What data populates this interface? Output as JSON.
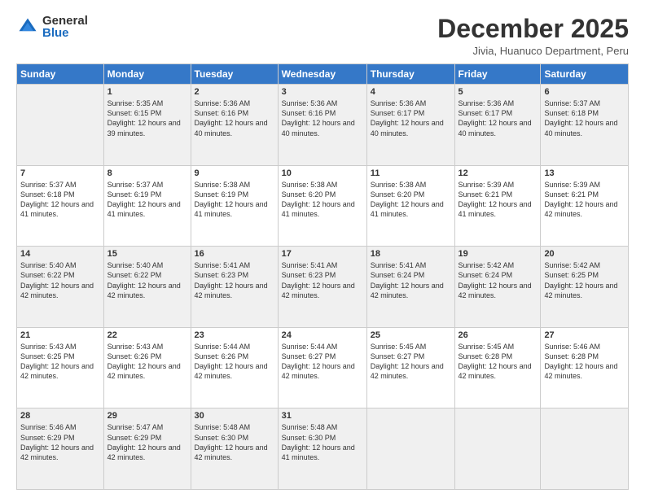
{
  "logo": {
    "general": "General",
    "blue": "Blue"
  },
  "header": {
    "title": "December 2025",
    "subtitle": "Jivia, Huanuco Department, Peru"
  },
  "columns": [
    "Sunday",
    "Monday",
    "Tuesday",
    "Wednesday",
    "Thursday",
    "Friday",
    "Saturday"
  ],
  "weeks": [
    [
      {
        "day": "",
        "sunrise": "",
        "sunset": "",
        "daylight": ""
      },
      {
        "day": "1",
        "sunrise": "Sunrise: 5:35 AM",
        "sunset": "Sunset: 6:15 PM",
        "daylight": "Daylight: 12 hours and 39 minutes."
      },
      {
        "day": "2",
        "sunrise": "Sunrise: 5:36 AM",
        "sunset": "Sunset: 6:16 PM",
        "daylight": "Daylight: 12 hours and 40 minutes."
      },
      {
        "day": "3",
        "sunrise": "Sunrise: 5:36 AM",
        "sunset": "Sunset: 6:16 PM",
        "daylight": "Daylight: 12 hours and 40 minutes."
      },
      {
        "day": "4",
        "sunrise": "Sunrise: 5:36 AM",
        "sunset": "Sunset: 6:17 PM",
        "daylight": "Daylight: 12 hours and 40 minutes."
      },
      {
        "day": "5",
        "sunrise": "Sunrise: 5:36 AM",
        "sunset": "Sunset: 6:17 PM",
        "daylight": "Daylight: 12 hours and 40 minutes."
      },
      {
        "day": "6",
        "sunrise": "Sunrise: 5:37 AM",
        "sunset": "Sunset: 6:18 PM",
        "daylight": "Daylight: 12 hours and 40 minutes."
      }
    ],
    [
      {
        "day": "7",
        "sunrise": "Sunrise: 5:37 AM",
        "sunset": "Sunset: 6:18 PM",
        "daylight": "Daylight: 12 hours and 41 minutes."
      },
      {
        "day": "8",
        "sunrise": "Sunrise: 5:37 AM",
        "sunset": "Sunset: 6:19 PM",
        "daylight": "Daylight: 12 hours and 41 minutes."
      },
      {
        "day": "9",
        "sunrise": "Sunrise: 5:38 AM",
        "sunset": "Sunset: 6:19 PM",
        "daylight": "Daylight: 12 hours and 41 minutes."
      },
      {
        "day": "10",
        "sunrise": "Sunrise: 5:38 AM",
        "sunset": "Sunset: 6:20 PM",
        "daylight": "Daylight: 12 hours and 41 minutes."
      },
      {
        "day": "11",
        "sunrise": "Sunrise: 5:38 AM",
        "sunset": "Sunset: 6:20 PM",
        "daylight": "Daylight: 12 hours and 41 minutes."
      },
      {
        "day": "12",
        "sunrise": "Sunrise: 5:39 AM",
        "sunset": "Sunset: 6:21 PM",
        "daylight": "Daylight: 12 hours and 41 minutes."
      },
      {
        "day": "13",
        "sunrise": "Sunrise: 5:39 AM",
        "sunset": "Sunset: 6:21 PM",
        "daylight": "Daylight: 12 hours and 42 minutes."
      }
    ],
    [
      {
        "day": "14",
        "sunrise": "Sunrise: 5:40 AM",
        "sunset": "Sunset: 6:22 PM",
        "daylight": "Daylight: 12 hours and 42 minutes."
      },
      {
        "day": "15",
        "sunrise": "Sunrise: 5:40 AM",
        "sunset": "Sunset: 6:22 PM",
        "daylight": "Daylight: 12 hours and 42 minutes."
      },
      {
        "day": "16",
        "sunrise": "Sunrise: 5:41 AM",
        "sunset": "Sunset: 6:23 PM",
        "daylight": "Daylight: 12 hours and 42 minutes."
      },
      {
        "day": "17",
        "sunrise": "Sunrise: 5:41 AM",
        "sunset": "Sunset: 6:23 PM",
        "daylight": "Daylight: 12 hours and 42 minutes."
      },
      {
        "day": "18",
        "sunrise": "Sunrise: 5:41 AM",
        "sunset": "Sunset: 6:24 PM",
        "daylight": "Daylight: 12 hours and 42 minutes."
      },
      {
        "day": "19",
        "sunrise": "Sunrise: 5:42 AM",
        "sunset": "Sunset: 6:24 PM",
        "daylight": "Daylight: 12 hours and 42 minutes."
      },
      {
        "day": "20",
        "sunrise": "Sunrise: 5:42 AM",
        "sunset": "Sunset: 6:25 PM",
        "daylight": "Daylight: 12 hours and 42 minutes."
      }
    ],
    [
      {
        "day": "21",
        "sunrise": "Sunrise: 5:43 AM",
        "sunset": "Sunset: 6:25 PM",
        "daylight": "Daylight: 12 hours and 42 minutes."
      },
      {
        "day": "22",
        "sunrise": "Sunrise: 5:43 AM",
        "sunset": "Sunset: 6:26 PM",
        "daylight": "Daylight: 12 hours and 42 minutes."
      },
      {
        "day": "23",
        "sunrise": "Sunrise: 5:44 AM",
        "sunset": "Sunset: 6:26 PM",
        "daylight": "Daylight: 12 hours and 42 minutes."
      },
      {
        "day": "24",
        "sunrise": "Sunrise: 5:44 AM",
        "sunset": "Sunset: 6:27 PM",
        "daylight": "Daylight: 12 hours and 42 minutes."
      },
      {
        "day": "25",
        "sunrise": "Sunrise: 5:45 AM",
        "sunset": "Sunset: 6:27 PM",
        "daylight": "Daylight: 12 hours and 42 minutes."
      },
      {
        "day": "26",
        "sunrise": "Sunrise: 5:45 AM",
        "sunset": "Sunset: 6:28 PM",
        "daylight": "Daylight: 12 hours and 42 minutes."
      },
      {
        "day": "27",
        "sunrise": "Sunrise: 5:46 AM",
        "sunset": "Sunset: 6:28 PM",
        "daylight": "Daylight: 12 hours and 42 minutes."
      }
    ],
    [
      {
        "day": "28",
        "sunrise": "Sunrise: 5:46 AM",
        "sunset": "Sunset: 6:29 PM",
        "daylight": "Daylight: 12 hours and 42 minutes."
      },
      {
        "day": "29",
        "sunrise": "Sunrise: 5:47 AM",
        "sunset": "Sunset: 6:29 PM",
        "daylight": "Daylight: 12 hours and 42 minutes."
      },
      {
        "day": "30",
        "sunrise": "Sunrise: 5:48 AM",
        "sunset": "Sunset: 6:30 PM",
        "daylight": "Daylight: 12 hours and 42 minutes."
      },
      {
        "day": "31",
        "sunrise": "Sunrise: 5:48 AM",
        "sunset": "Sunset: 6:30 PM",
        "daylight": "Daylight: 12 hours and 41 minutes."
      },
      {
        "day": "",
        "sunrise": "",
        "sunset": "",
        "daylight": ""
      },
      {
        "day": "",
        "sunrise": "",
        "sunset": "",
        "daylight": ""
      },
      {
        "day": "",
        "sunrise": "",
        "sunset": "",
        "daylight": ""
      }
    ]
  ]
}
